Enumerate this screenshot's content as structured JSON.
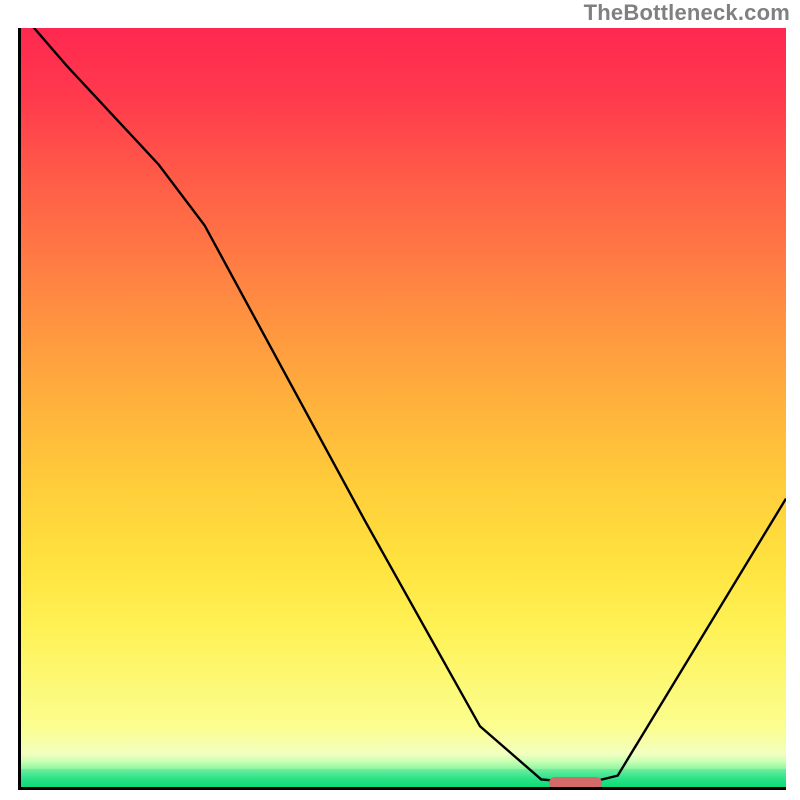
{
  "watermark": "TheBottleneck.com",
  "colors": {
    "gradient_top": "#ff2850",
    "gradient_mid": "#ffd23c",
    "gradient_low": "#fbfe90",
    "gradient_green": "#10db78",
    "axis": "#000000",
    "curve": "#000000",
    "marker": "#d46a6a"
  },
  "chart_data": {
    "type": "line",
    "title": "",
    "xlabel": "",
    "ylabel": "",
    "xlim": [
      0,
      100
    ],
    "ylim": [
      0,
      100
    ],
    "x": [
      0,
      6,
      18,
      24,
      45,
      60,
      68,
      74,
      78,
      100
    ],
    "values": [
      102,
      95,
      82,
      74,
      35,
      8,
      1,
      0.5,
      1.5,
      38
    ],
    "optimal_range": {
      "x_start": 69,
      "x_end": 76,
      "y": 0.5,
      "note": "red pill marker at curve minimum"
    },
    "description": "V-shaped bottleneck curve over vertical red-to-green gradient; minimum near x≈72 touching green band"
  }
}
